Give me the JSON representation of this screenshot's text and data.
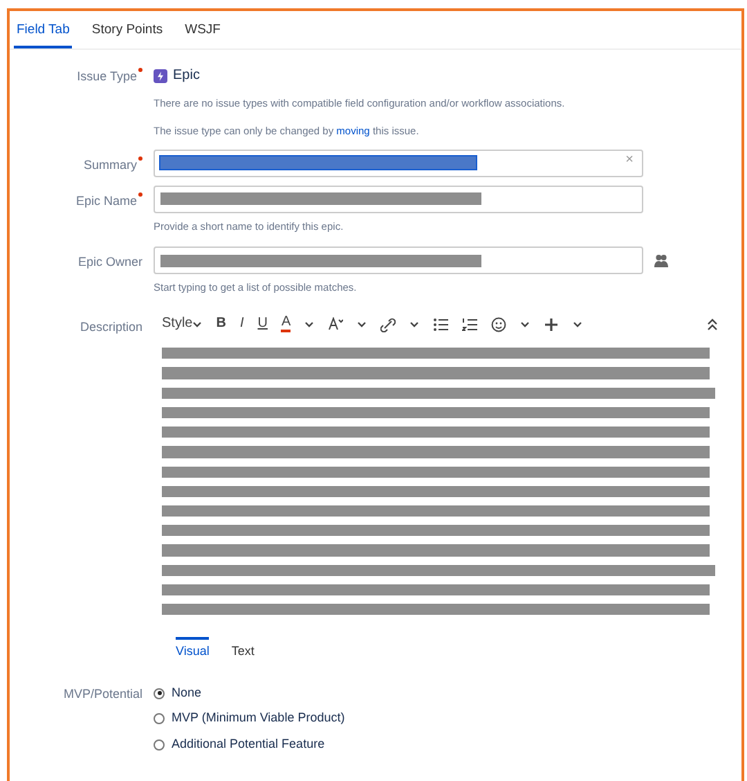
{
  "tabs": [
    {
      "label": "Field Tab",
      "selected": true
    },
    {
      "label": "Story Points",
      "selected": false
    },
    {
      "label": "WSJF",
      "selected": false
    }
  ],
  "issue_type": {
    "label": "Issue Type",
    "required": true,
    "value": "Epic",
    "note": "There are no issue types with compatible field configuration and/or workflow associations.",
    "change_note": "The issue type can only be changed by **moving** this issue."
  },
  "summary": {
    "label": "Summary",
    "required": true,
    "redacted": true,
    "selected": true,
    "clear": "×"
  },
  "epic_name": {
    "label": "Epic Name",
    "required": true,
    "redacted": true,
    "help": "Provide a short name to identify this epic."
  },
  "epic_owner": {
    "label": "Epic Owner",
    "redacted": true,
    "help": "Start typing to get a list of possible matches."
  },
  "description": {
    "label": "Description",
    "toolbar": [
      {
        "kind": "dropdown",
        "label": "Style"
      },
      {
        "kind": "text",
        "label": "B"
      },
      {
        "kind": "text",
        "label": "I"
      },
      {
        "kind": "text",
        "label": "U"
      },
      {
        "kind": "color",
        "label": "A"
      }
    ],
    "redacted": true,
    "modes": [
      {
        "label": "Visual",
        "selected": true
      },
      {
        "label": "Text",
        "selected": false
      }
    ]
  },
  "mvp": {
    "label": "MVP/Potential",
    "options": [
      {
        "label": "None",
        "selected": true
      },
      {
        "label": "MVP (Minimum Viable Product)",
        "selected": false
      },
      {
        "label": "Additional Potential Feature",
        "selected": false
      }
    ]
  }
}
